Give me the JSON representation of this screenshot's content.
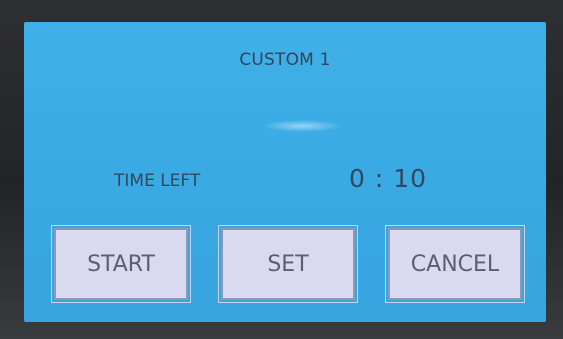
{
  "screen": {
    "title": "CUSTOM 1",
    "time_left_label": "TIME LEFT",
    "time_left_value": "0 : 10",
    "background_color": "#3aaae4"
  },
  "buttons": {
    "start": "START",
    "set": "SET",
    "cancel": "CANCEL"
  }
}
